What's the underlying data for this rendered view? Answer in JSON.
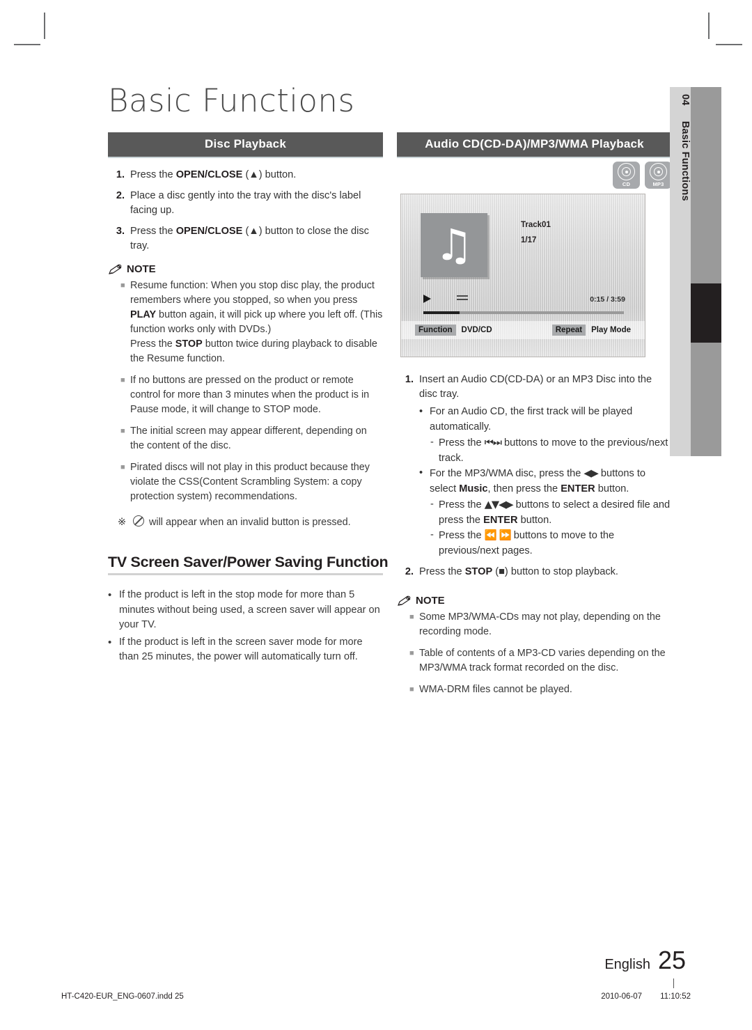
{
  "page_title": "Basic Functions",
  "sidebar": {
    "chapter_number": "04",
    "chapter_name": "Basic Functions"
  },
  "left_column": {
    "section_title": "Disc Playback",
    "steps": [
      {
        "num": "1.",
        "html": "Press the <b>OPEN/CLOSE</b> (▲) button."
      },
      {
        "num": "2.",
        "html": "Place a disc gently into the tray with the disc's label facing up."
      },
      {
        "num": "3.",
        "html": "Press the <b>OPEN/CLOSE</b> (▲) button to close the disc tray."
      }
    ],
    "note_label": "NOTE",
    "notes": [
      "Resume function: When you stop disc play, the product remembers where you stopped, so when you press <b>PLAY</b> button again, it will pick up where you left off. (This function works only with DVDs.)<br>Press the <b>STOP</b> button twice during playback to disable the Resume function.",
      "If no buttons are pressed on the product or remote control for more than 3 minutes when the product is in Pause mode, it will change to STOP mode.",
      "The initial screen may appear different, depending on the content of the disc.",
      "Pirated discs will not play in this product because they violate the CSS(Content Scrambling System: a copy protection system) recommendations."
    ],
    "star_note": {
      "marker": "※",
      "text": "will appear when an invalid button is pressed."
    },
    "sub_heading": "TV Screen Saver/Power Saving Function",
    "sub_bullets": [
      "If the product is left in the stop mode for more than 5 minutes without being used, a screen saver will appear on your TV.",
      "If the product is left in the screen saver mode for more than 25 minutes, the power will automatically turn off."
    ]
  },
  "right_column": {
    "section_title": "Audio CD(CD-DA)/MP3/WMA Playback",
    "disc_icons": [
      {
        "label": "CD",
        "icon": "disc-icon"
      },
      {
        "label": "MP3",
        "icon": "disc-icon"
      }
    ],
    "screen": {
      "album_art_icon": "music-note-icon",
      "track_name": "Track01",
      "track_index": "1/17",
      "play_icon": "play-icon",
      "repeat_icon": "repeat-icon",
      "time_display": "0:15 / 3:59",
      "progress_percent": 18,
      "status_bar": {
        "function_key": "Function",
        "function_value": "DVD/CD",
        "repeat_key": "Repeat",
        "repeat_value": "Play Mode"
      }
    },
    "steps": [
      {
        "num": "1.",
        "html": "Insert an Audio CD(CD-DA) or an MP3 Disc into the disc tray.",
        "sub": [
          {
            "text": "For an Audio CD, the first track will be played automatically.",
            "dashes": [
              "Press the <span class=\"glyph\">⏮⏭</span> buttons to move to the previous/next track."
            ]
          },
          {
            "text": "For the MP3/WMA disc, press the <span class=\"glyph\">◀▶</span> buttons to select <b>Music</b>, then press the <b>ENTER</b> button.",
            "dashes": [
              "Press the <span class=\"glyph\">▲▼◀▶</span> buttons to select  a desired file and press the <b>ENTER</b> button.",
              "Press the <span class=\"glyph\">⏪ ⏩</span> buttons to move to the previous/next pages."
            ]
          }
        ]
      },
      {
        "num": "2.",
        "html": "Press the <b>STOP</b> (■) button to stop playback.",
        "sub": []
      }
    ],
    "note_label": "NOTE",
    "notes": [
      "Some MP3/WMA-CDs may not play, depending on the recording mode.",
      "Table of contents of a MP3-CD varies depending on the MP3/WMA track format recorded on the disc.",
      "WMA-DRM files cannot be played."
    ]
  },
  "footer": {
    "language": "English",
    "page_number": "25",
    "imprint_file": "HT-C420-EUR_ENG-0607.indd   25",
    "imprint_date": "2010-06-07",
    "imprint_time": "11:10:52"
  }
}
